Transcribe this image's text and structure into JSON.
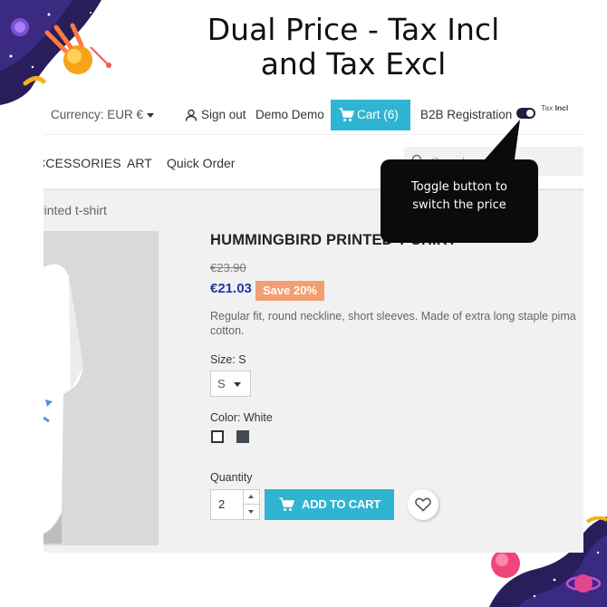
{
  "headline": [
    "Dual Price - Tax Incl",
    "and Tax Excl"
  ],
  "topbar": {
    "currency": "Currency: EUR €",
    "sign_in": "Sign out",
    "user": "Demo Demo",
    "cart": "Cart (6)",
    "b2b": "B2B Registration",
    "tax_toggle": {
      "state": "on",
      "label_prefix": "Tax ",
      "label_bold": "Incl"
    }
  },
  "navbar": {
    "items": [
      "CCESSORIES",
      "ART",
      "Quick Order"
    ],
    "search_placeholder": "Search"
  },
  "breadcrumb": "rinted t-shirt",
  "product": {
    "title": "HUMMINGBIRD PRINTED T-SHIRT",
    "old_price": "€23.90",
    "new_price": "€21.03",
    "discount": "Save 20%",
    "description": "Regular fit, round neckline, short sleeves. Made of extra long staple pima cotton.",
    "size_label": "Size: S",
    "size_value": "S",
    "color_label": "Color: White",
    "colors": [
      "#ffffff",
      "#434a54"
    ],
    "quantity_label": "Quantity",
    "quantity": "2",
    "add_to_cart": "ADD TO CART"
  },
  "tooltip": [
    "Toggle button to",
    "switch the price"
  ],
  "colors": {
    "accent": "#2fb5d2",
    "price": "#2834a5",
    "discount": "#f39d72",
    "toggle": "#1c1f3c"
  }
}
